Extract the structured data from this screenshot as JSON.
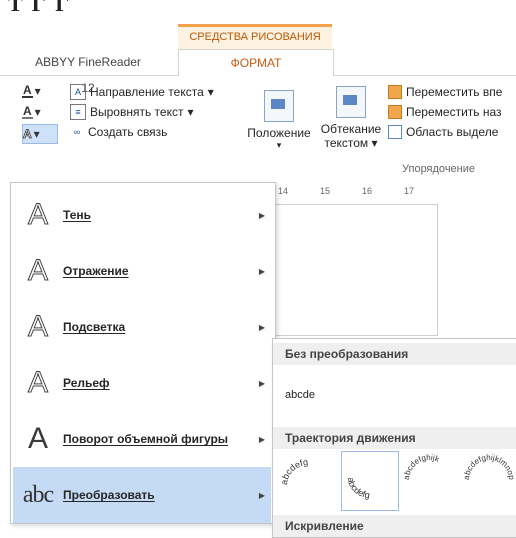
{
  "top_strip": {
    "text": "T          Г   Г"
  },
  "ribbon": {
    "context_group": "СРЕДСТВА РИСОВАНИЯ",
    "tabs": [
      {
        "label": "ABBYY FineReader 12"
      },
      {
        "label": "ФОРМАТ"
      }
    ],
    "text_group": {
      "direction": "Направление текста",
      "align": "Выровнять текст",
      "link": "Создать связь"
    },
    "position_label": "Положение",
    "wrap_label_1": "Обтекание",
    "wrap_label_2": "текстом",
    "arrange": {
      "forward": "Переместить впе",
      "backward": "Переместить наз",
      "selection": "Область выделе"
    },
    "arrange_group_label": "Упорядочение"
  },
  "ruler": {
    "t1": "14",
    "t2": "15",
    "t3": "16",
    "t4": "17"
  },
  "menu": {
    "items": [
      {
        "label": "Тень"
      },
      {
        "label": "Отражение"
      },
      {
        "label": "Подсветка"
      },
      {
        "label": "Рельеф"
      },
      {
        "label": "Поворот объемной фигуры"
      },
      {
        "label": "Преобразовать",
        "icon_text": "abc"
      }
    ]
  },
  "submenu": {
    "section_no_transform": "Без преобразования",
    "sample": "abcde",
    "section_path": "Траектория движения",
    "section_warp": "Искривление",
    "path_samples": [
      "abcdefg",
      "abcdefg",
      "abcdefghijk",
      "abcdefghijklmnop"
    ]
  }
}
